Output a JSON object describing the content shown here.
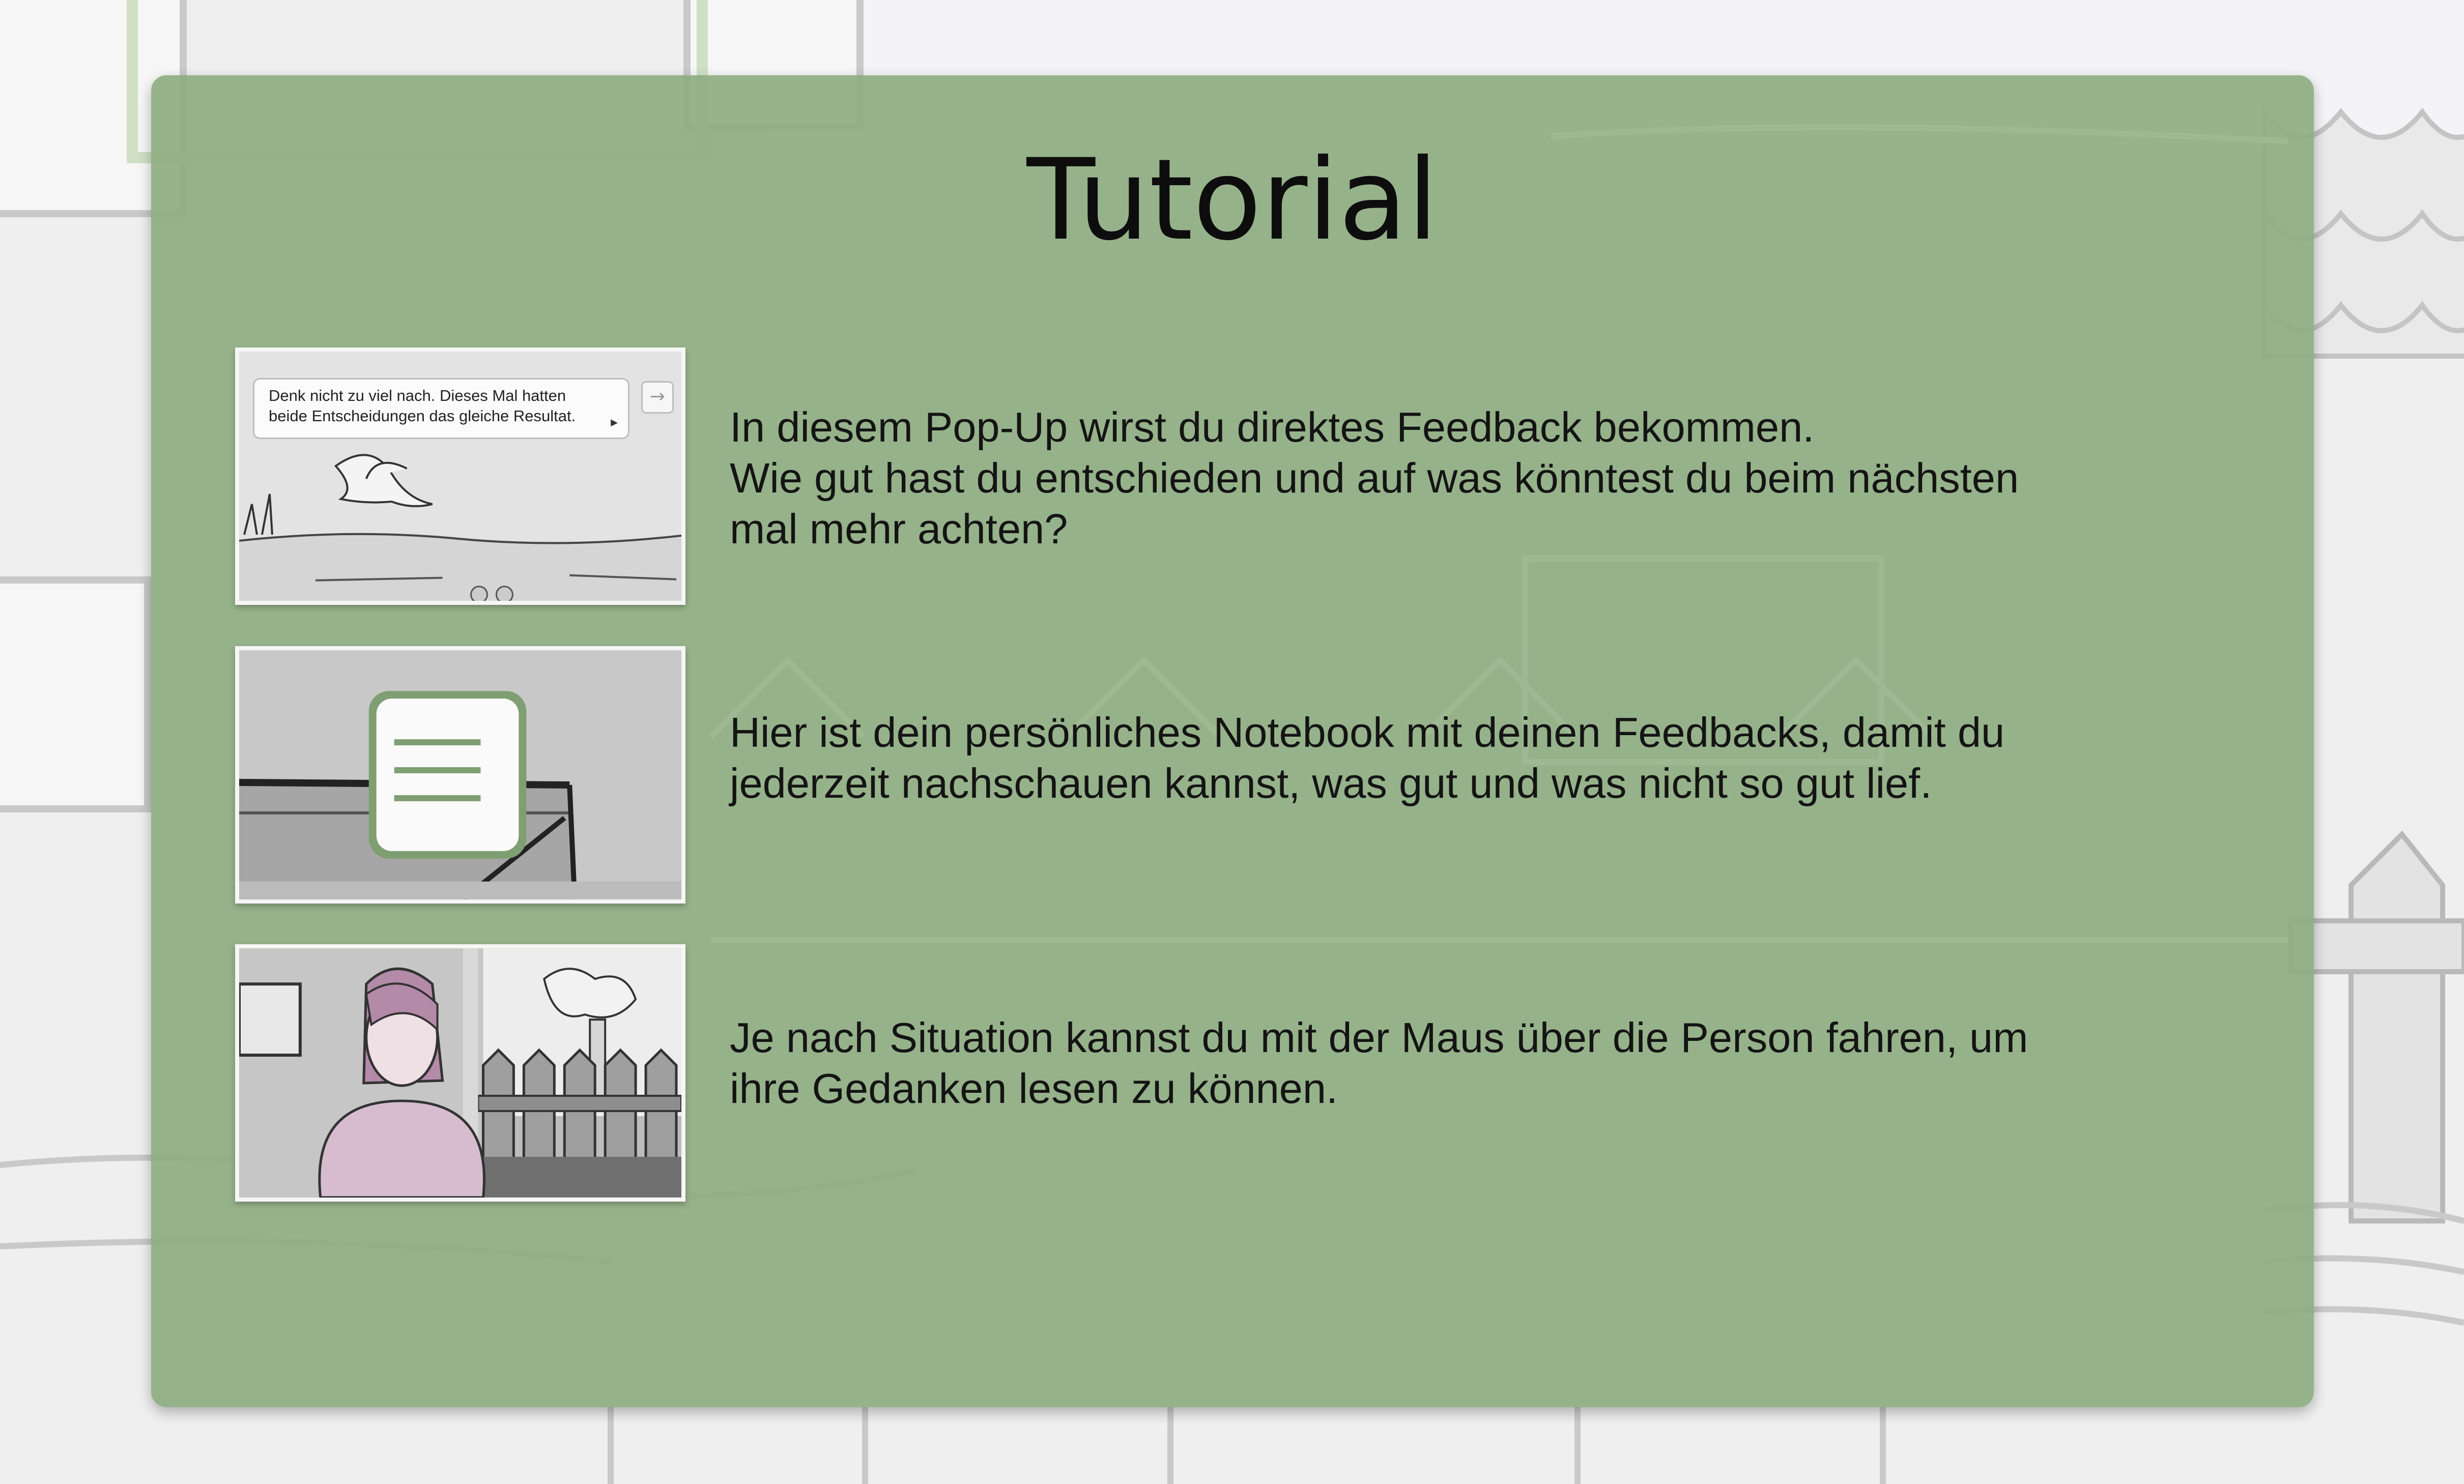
{
  "window": {
    "title": "Tutorial"
  },
  "items": [
    {
      "icon": "feedback-popup-thumbnail",
      "popup_text": [
        "Denk nicht zu  viel nach. Dieses Mal hatten",
        "beide Entscheidungen das gleiche Resultat."
      ],
      "lines": [
        "In diesem Pop-Up wirst du direktes Feedback bekommen.",
        "Wie gut hast du entschieden und auf was könntest du beim nächsten",
        "mal mehr achten?"
      ]
    },
    {
      "icon": "notebook-icon",
      "lines": [
        "Hier ist dein persönliches Notebook mit deinen Feedbacks, damit du",
        "jederzeit nachschauen kannst, was gut und was nicht so gut lief."
      ]
    },
    {
      "icon": "person-thoughts-thumbnail",
      "lines": [
        "Je nach Situation kannst du mit der Maus über die Person fahren, um",
        "ihre Gedanken lesen zu können."
      ]
    }
  ],
  "colors": {
    "panel": "#8fad82",
    "accent_green": "#7f9e72",
    "background": "#eeeeee",
    "person_shirt": "#d7bcd0",
    "person_hair": "#b48aa9"
  }
}
